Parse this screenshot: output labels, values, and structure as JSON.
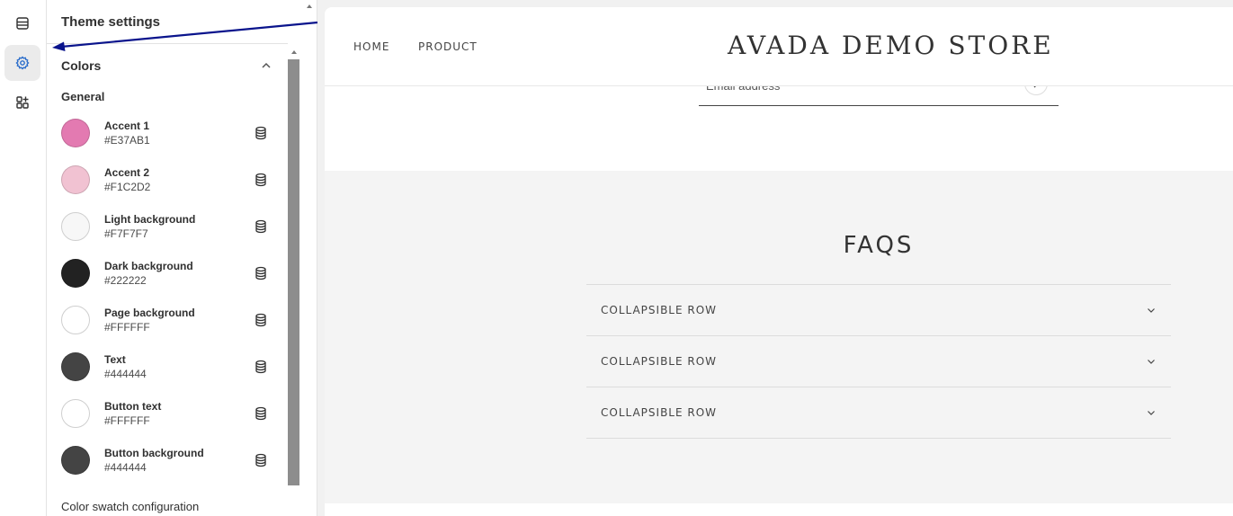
{
  "rail": {
    "items": [
      {
        "icon": "sections-icon",
        "active": false
      },
      {
        "icon": "gear-icon",
        "active": true
      },
      {
        "icon": "apps-icon",
        "active": false
      }
    ]
  },
  "panel": {
    "title": "Theme settings",
    "section_title": "Colors",
    "group_label": "General",
    "colors": [
      {
        "name": "Accent 1",
        "hex": "#E37AB1",
        "swatch": "#E37AB1"
      },
      {
        "name": "Accent 2",
        "hex": "#F1C2D2",
        "swatch": "#F1C2D2"
      },
      {
        "name": "Light background",
        "hex": "#F7F7F7",
        "swatch": "#F7F7F7"
      },
      {
        "name": "Dark background",
        "hex": "#222222",
        "swatch": "#222222"
      },
      {
        "name": "Page background",
        "hex": "#FFFFFF",
        "swatch": "#FFFFFF"
      },
      {
        "name": "Text",
        "hex": "#444444",
        "swatch": "#444444"
      },
      {
        "name": "Button text",
        "hex": "#FFFFFF",
        "swatch": "#FFFFFF"
      },
      {
        "name": "Button background",
        "hex": "#444444",
        "swatch": "#444444"
      }
    ],
    "footer_label": "Color swatch configuration"
  },
  "preview": {
    "nav": [
      {
        "label": "HOME"
      },
      {
        "label": "PRODUCT"
      }
    ],
    "store_name": "AVADA DEMO STORE",
    "email_placeholder": "Email address",
    "faq_title": "FAQS",
    "faq_rows": [
      {
        "label": "COLLAPSIBLE ROW"
      },
      {
        "label": "COLLAPSIBLE ROW"
      },
      {
        "label": "COLLAPSIBLE ROW"
      }
    ]
  },
  "annotation": {
    "color": "#0a148c"
  }
}
